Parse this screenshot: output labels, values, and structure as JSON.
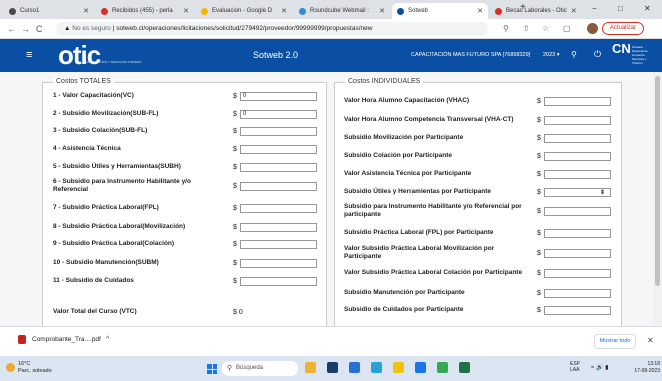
{
  "browser": {
    "tabs": [
      {
        "label": "Curso1",
        "color": "#4a4a4a"
      },
      {
        "label": "Recibidos (455) - perla",
        "color": "#d93025"
      },
      {
        "label": "Evaluacion - Google D",
        "color": "#f4b400"
      },
      {
        "label": "Roundcube Webmail :",
        "color": "#2a8fd6"
      },
      {
        "label": "Sotweb",
        "color": "#0a4fa3"
      },
      {
        "label": "Becas Laborales - Otic",
        "color": "#d93025"
      }
    ],
    "new_tab": "+",
    "minimize": "−",
    "maximize": "□",
    "close": "✕",
    "back": "←",
    "forward": "→",
    "reload": "C",
    "security_text": "No es seguro",
    "url": "sotweb.cl/operaciones/licitaciones/solicitud/279492/proveedor/99999999/propuestas/new",
    "update_label": "Actualizar"
  },
  "app": {
    "menu": "≡",
    "logo": "otic",
    "logo_sub": "CAPACITACIÓN Y SERVICIOS TURISMO",
    "title": "Sotweb 2.0",
    "company": "CAPACITACIÓN MAS FUTURO SPA [76898329]",
    "year": "2023 ▾",
    "cn_logo": "CN",
    "cn_text": "Cámara Nacional de Comercio Servicios y Turismo"
  },
  "totales": {
    "legend": "Costos TOTALES",
    "currency": "$",
    "rows": [
      {
        "label": "1 - Valor Capacitación(VC)",
        "value": "0"
      },
      {
        "label": "2 - Subsidio Movilización(SUB-FL)",
        "value": "0"
      },
      {
        "label": "3 - Subsidio Colación(SUB-FL)",
        "value": ""
      },
      {
        "label": "4 - Asistencia Técnica",
        "value": ""
      },
      {
        "label": "5 - Subsidio Útiles y Herramientas(SUBH)",
        "value": ""
      },
      {
        "label": "6 - Subsidio para Instrumento Habilitante y/o Referencial",
        "value": ""
      },
      {
        "label": "7 - Subsidio Práctica Laboral(FPL)",
        "value": ""
      },
      {
        "label": "8 - Subsidio Práctica Laboral(Movilización)",
        "value": ""
      },
      {
        "label": "9 - Subsidio Práctica Laboral(Colación)",
        "value": ""
      },
      {
        "label": "10 - Subsidio Manutención(SUBM)",
        "value": ""
      },
      {
        "label": "11 - Subsidio de Cuidados",
        "value": ""
      }
    ],
    "total_label": "Valor Total del Curso (VTC)",
    "total_value": "$ 0"
  },
  "individuales": {
    "legend": "Costos INDIVIDUALES",
    "currency": "$",
    "rows": [
      {
        "label": "Valor Hora Alumno Capacitación (VHAC)",
        "value": ""
      },
      {
        "label": "Valor Hora Alumno Competencia Transversal (VHA-CT)",
        "value": ""
      },
      {
        "label": "Subsidio Movilización por Participante",
        "value": ""
      },
      {
        "label": "Subsidio Colación por Participante",
        "value": ""
      },
      {
        "label": "Valor Asistencia Técnica por Participante",
        "value": ""
      },
      {
        "label": "Subsidio Útiles y Herramientas por Participante",
        "value": "",
        "spinner": "⇕"
      },
      {
        "label": "Subsidio para Instrumento Habilitante y/o Referencial por participante",
        "value": ""
      },
      {
        "label": "Subsidio Práctica Laboral (FPL) por Participante",
        "value": ""
      },
      {
        "label": "Valor Subsidio Práctica Laboral Movilización por Participante",
        "value": ""
      },
      {
        "label": "Valor Subsidio Práctica Laboral Colación por Participante",
        "value": ""
      },
      {
        "label": "Subsidio Manutención por Participante",
        "value": ""
      },
      {
        "label": "Subsidio de Cuidados por Participante",
        "value": ""
      }
    ]
  },
  "downloads": {
    "file": "Comprobante_Tra....pdf",
    "chevron": "^",
    "show_all": "Mostrar todo",
    "close": "✕"
  },
  "taskbar": {
    "weather_temp": "16°C",
    "weather_desc": "Parc. soleado",
    "search": "Búsqueda",
    "lang_top": "ESP",
    "lang_bottom": "LAA",
    "time": "13:18",
    "date": "17-08-2023",
    "app_colors": [
      "#f0b030",
      "#1a3b6e",
      "#2a6fd6",
      "#2aa1d6",
      "#f4c20d",
      "#1a73e8",
      "#34a853",
      "#1e7145"
    ]
  }
}
